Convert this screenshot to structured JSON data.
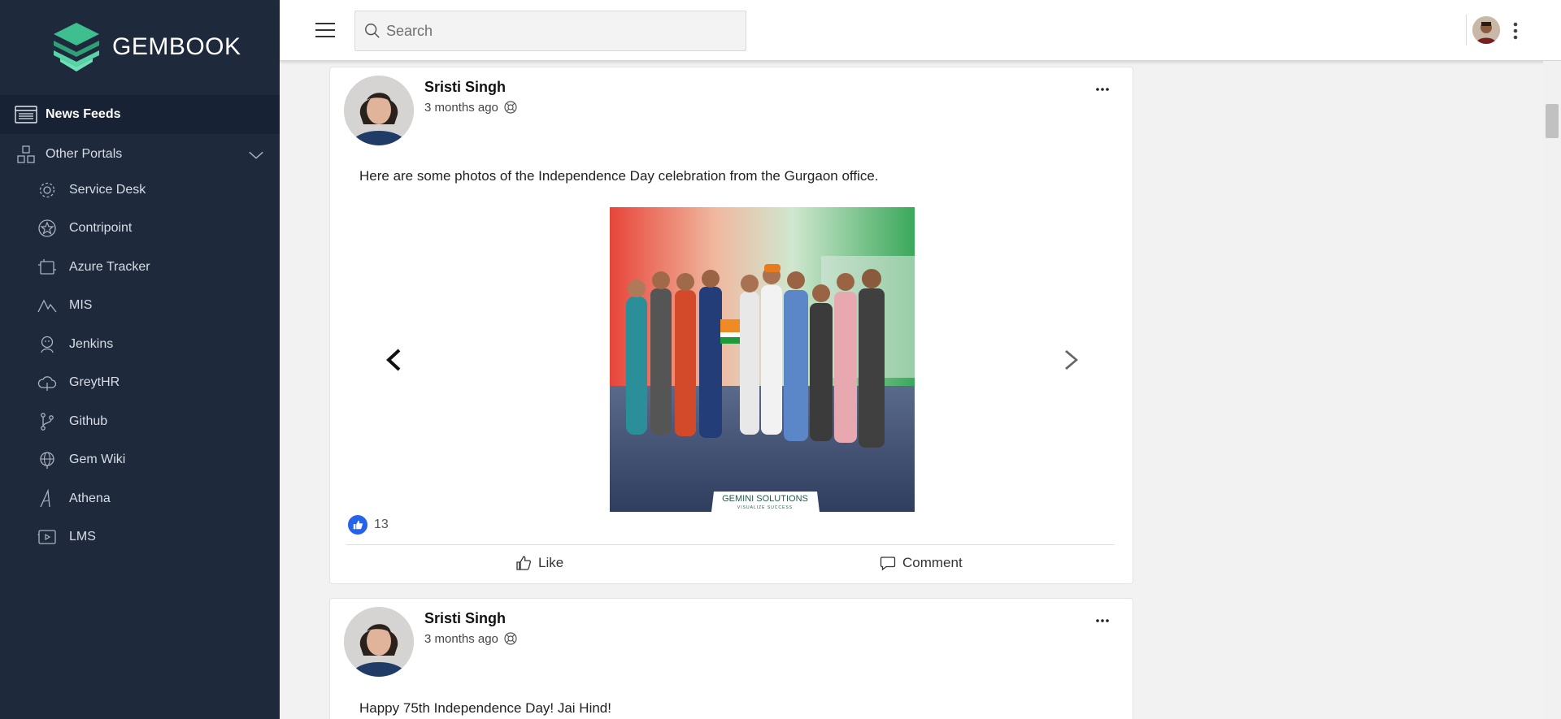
{
  "brand": {
    "name": "GEMBOOK"
  },
  "sidebar": {
    "active": {
      "label": "News Feeds",
      "icon": "news-icon"
    },
    "group": {
      "label": "Other Portals",
      "icon": "portals-icon"
    },
    "items": [
      {
        "label": "Service Desk",
        "icon": "gear-icon"
      },
      {
        "label": "Contripoint",
        "icon": "star-icon"
      },
      {
        "label": "Azure Tracker",
        "icon": "tracker-icon"
      },
      {
        "label": "MIS",
        "icon": "chart-icon"
      },
      {
        "label": "Jenkins",
        "icon": "jenkins-icon"
      },
      {
        "label": "GreytHR",
        "icon": "cloud-icon"
      },
      {
        "label": "Github",
        "icon": "branch-icon"
      },
      {
        "label": "Gem Wiki",
        "icon": "globe-icon"
      },
      {
        "label": "Athena",
        "icon": "athena-icon"
      },
      {
        "label": "LMS",
        "icon": "video-icon"
      }
    ]
  },
  "search": {
    "placeholder": "Search",
    "value": ""
  },
  "posts": [
    {
      "author": "Sristi Singh",
      "time": "3 months ago",
      "text": "Here are some photos of the Independence Day celebration from the Gurgaon office.",
      "photo_caption": "GEMINI SOLUTIONS",
      "photo_tagline": "VISUALIZE SUCCESS",
      "likes": "13",
      "actions": {
        "like": "Like",
        "comment": "Comment"
      }
    },
    {
      "author": "Sristi Singh",
      "time": "3 months ago",
      "text": "Happy 75th Independence Day! Jai Hind!"
    }
  ],
  "colors": {
    "sidebar": "#1e293b",
    "sidebar_active": "#172235",
    "accent": "#2563eb",
    "logo": "#3fbf8f"
  }
}
